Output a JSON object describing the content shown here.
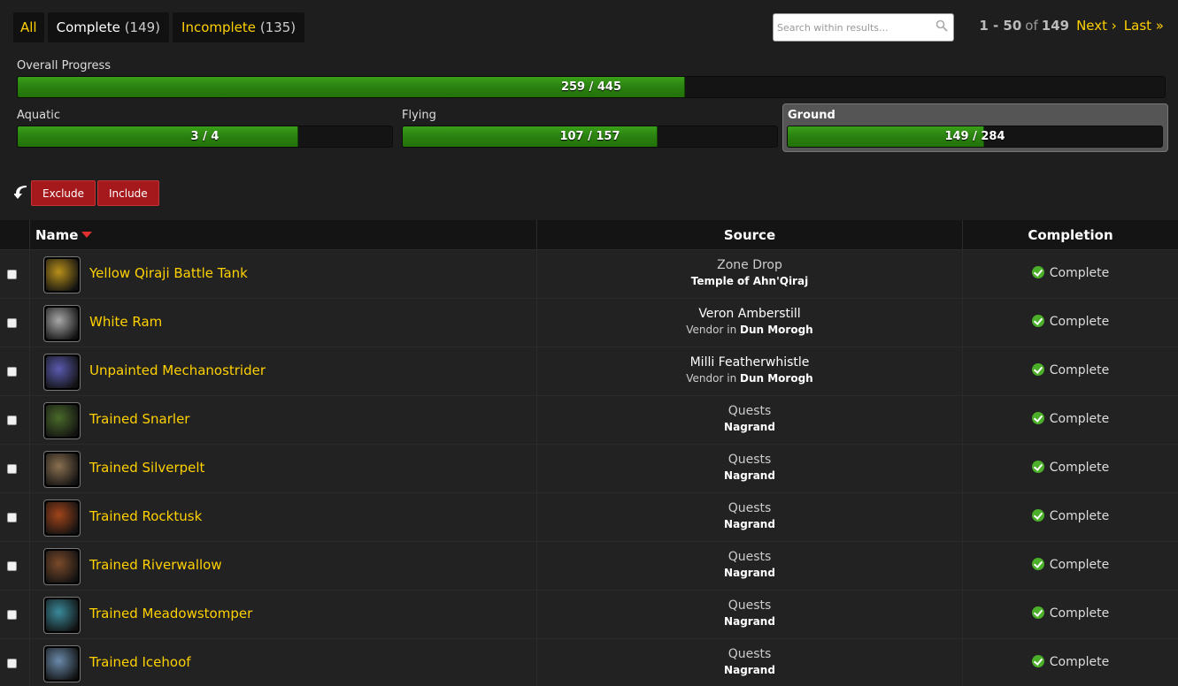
{
  "filters": {
    "all_label": "All",
    "complete_label": "Complete",
    "complete_count": "(149)",
    "incomplete_label": "Incomplete",
    "incomplete_count": "(135)"
  },
  "search": {
    "placeholder": "Search within results..."
  },
  "pagination": {
    "range": "1 - 50",
    "of_label": "of",
    "total": "149",
    "next_label": "Next ›",
    "last_label": "Last »"
  },
  "progress": {
    "overall": {
      "label": "Overall Progress",
      "text": "259 / 445",
      "value": 259,
      "max": 445
    },
    "aquatic": {
      "label": "Aquatic",
      "text": "3 / 4",
      "value": 3,
      "max": 4
    },
    "flying": {
      "label": "Flying",
      "text": "107 / 157",
      "value": 107,
      "max": 157
    },
    "ground": {
      "label": "Ground",
      "text": "149 / 284",
      "value": 149,
      "max": 284
    }
  },
  "actions": {
    "exclude_label": "Exclude",
    "include_label": "Include"
  },
  "table": {
    "headers": {
      "name": "Name",
      "source": "Source",
      "completion": "Completion"
    },
    "rows": [
      {
        "name": "Yellow Qiraji Battle Tank",
        "source_main": "Zone Drop",
        "source_type": "",
        "source_zone": "Temple of Ahn'Qiraj",
        "status": "Complete",
        "icon": "qiraji-tank-icon",
        "icon_color": "#b8901a"
      },
      {
        "name": "White Ram",
        "source_main": "Veron Amberstill",
        "source_type": "Vendor in",
        "source_zone": "Dun Morogh",
        "status": "Complete",
        "icon": "ram-icon",
        "icon_color": "#a8a8a8"
      },
      {
        "name": "Unpainted Mechanostrider",
        "source_main": "Milli Featherwhistle",
        "source_type": "Vendor in",
        "source_zone": "Dun Morogh",
        "status": "Complete",
        "icon": "mechanostrider-icon",
        "icon_color": "#5a5ab0"
      },
      {
        "name": "Trained Snarler",
        "source_main": "Quests",
        "source_type": "",
        "source_zone": "Nagrand",
        "status": "Complete",
        "icon": "wolf-icon",
        "icon_color": "#4a6a2a"
      },
      {
        "name": "Trained Silverpelt",
        "source_main": "Quests",
        "source_type": "",
        "source_zone": "Nagrand",
        "status": "Complete",
        "icon": "wolf-icon",
        "icon_color": "#8a7050"
      },
      {
        "name": "Trained Rocktusk",
        "source_main": "Quests",
        "source_type": "",
        "source_zone": "Nagrand",
        "status": "Complete",
        "icon": "boar-icon",
        "icon_color": "#a0441a"
      },
      {
        "name": "Trained Riverwallow",
        "source_main": "Quests",
        "source_type": "",
        "source_zone": "Nagrand",
        "status": "Complete",
        "icon": "riverbeast-icon",
        "icon_color": "#7a4a2a"
      },
      {
        "name": "Trained Meadowstomper",
        "source_main": "Quests",
        "source_type": "",
        "source_zone": "Nagrand",
        "status": "Complete",
        "icon": "talbuk-icon",
        "icon_color": "#3a8a9a"
      },
      {
        "name": "Trained Icehoof",
        "source_main": "Quests",
        "source_type": "",
        "source_zone": "Nagrand",
        "status": "Complete",
        "icon": "elekk-icon",
        "icon_color": "#6a8aaa"
      }
    ]
  },
  "colors": {
    "accent": "#ffd100",
    "progress_fill": "#2a8010",
    "button_red": "#a5181b"
  }
}
